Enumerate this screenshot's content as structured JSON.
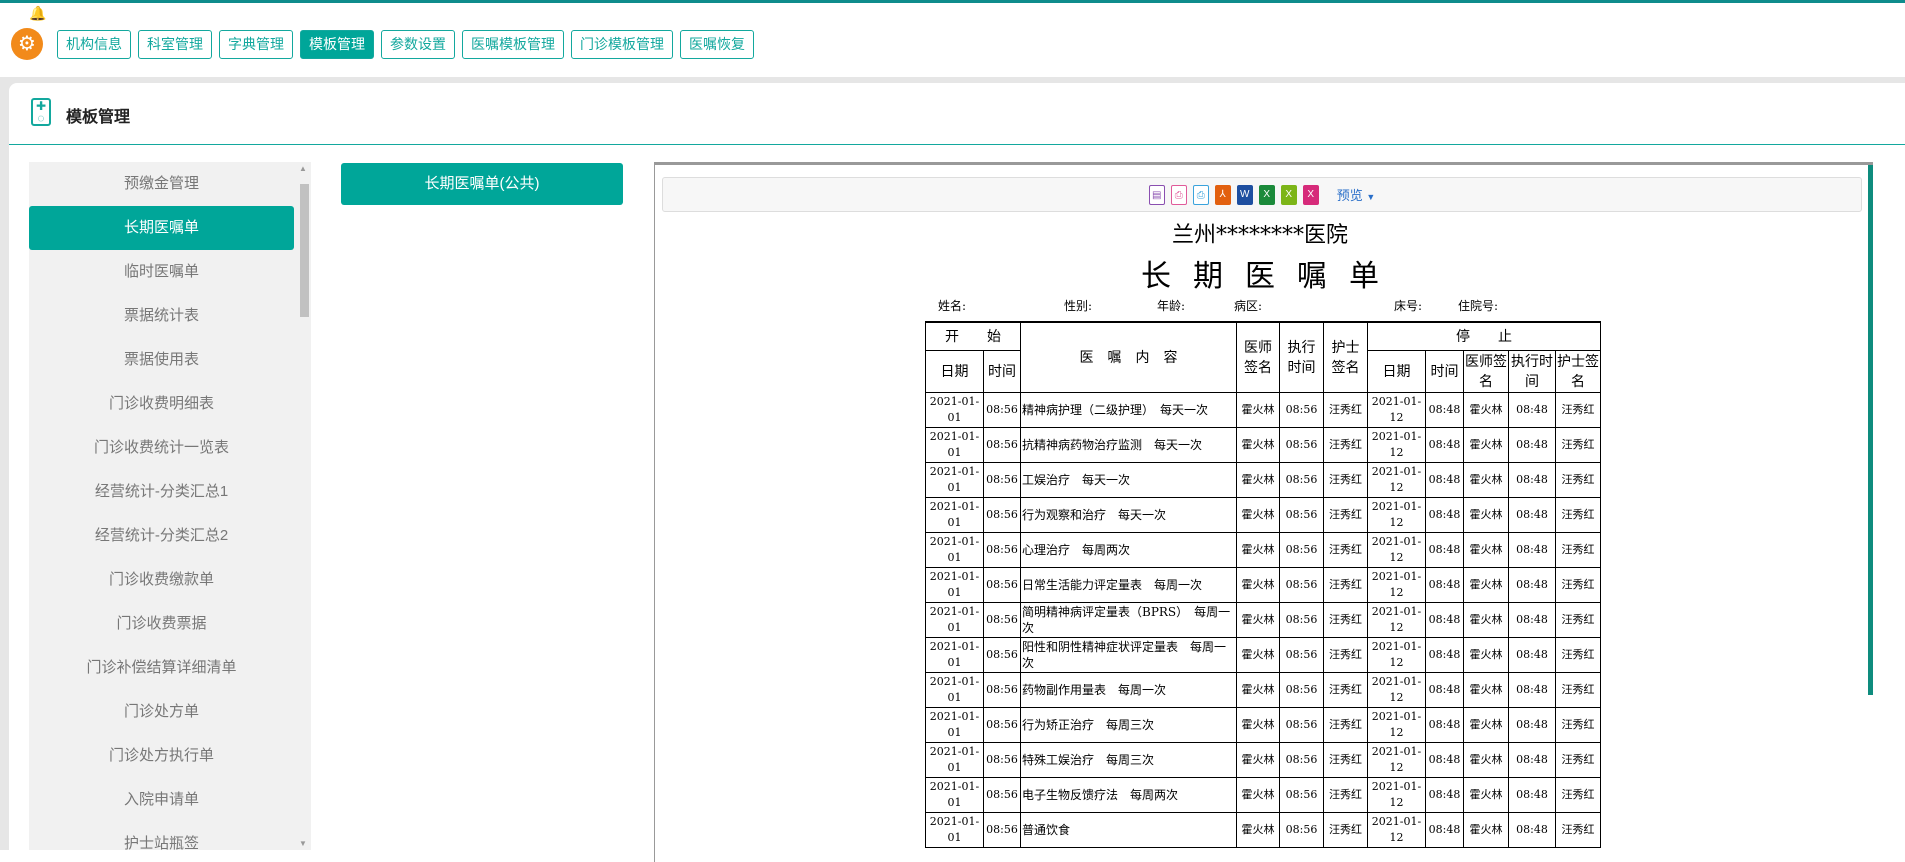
{
  "nav": {
    "items": [
      "机构信息",
      "科室管理",
      "字典管理",
      "模板管理",
      "参数设置",
      "医嘱模板管理",
      "门诊模板管理",
      "医嘱恢复"
    ],
    "active": 3
  },
  "page": {
    "title": "模板管理"
  },
  "sidebar": {
    "items": [
      "预缴金管理",
      "长期医嘱单",
      "临时医嘱单",
      "票据统计表",
      "票据使用表",
      "门诊收费明细表",
      "门诊收费统计一览表",
      "经营统计-分类汇总1",
      "经营统计-分类汇总2",
      "门诊收费缴款单",
      "门诊收费票据",
      "门诊补偿结算详细清单",
      "门诊处方单",
      "门诊处方执行单",
      "入院申请单",
      "护士站瓶签"
    ],
    "active": 1
  },
  "template": {
    "label": "长期医嘱单(公共)"
  },
  "toolbar": {
    "preview": "预览"
  },
  "doc": {
    "hospital": "兰州********医院",
    "title": "长期医嘱单",
    "info": {
      "name": "姓名:",
      "sex": "性别:",
      "age": "年龄:",
      "ward": "病区:",
      "bed": "床号:",
      "inpatient": "住院号:"
    },
    "headers": {
      "start": "开　　始",
      "content": "医　嘱　内　容",
      "doctor": "医师签名",
      "exec": "执行时间",
      "nurse": "护士签名",
      "stop": "停　　止",
      "date": "日期",
      "time": "时间"
    },
    "rows": [
      [
        "2021-01-01",
        "08:56",
        "精神病护理（二级护理）　每天一次",
        "霍火林",
        "08:56",
        "汪秀红",
        "2021-01-12",
        "08:48",
        "霍火林",
        "08:48",
        "汪秀红"
      ],
      [
        "2021-01-01",
        "08:56",
        "抗精神病药物治疗监测　每天一次",
        "霍火林",
        "08:56",
        "汪秀红",
        "2021-01-12",
        "08:48",
        "霍火林",
        "08:48",
        "汪秀红"
      ],
      [
        "2021-01-01",
        "08:56",
        "工娱治疗　每天一次",
        "霍火林",
        "08:56",
        "汪秀红",
        "2021-01-12",
        "08:48",
        "霍火林",
        "08:48",
        "汪秀红"
      ],
      [
        "2021-01-01",
        "08:56",
        "行为观察和治疗　每天一次",
        "霍火林",
        "08:56",
        "汪秀红",
        "2021-01-12",
        "08:48",
        "霍火林",
        "08:48",
        "汪秀红"
      ],
      [
        "2021-01-01",
        "08:56",
        "心理治疗　每周两次",
        "霍火林",
        "08:56",
        "汪秀红",
        "2021-01-12",
        "08:48",
        "霍火林",
        "08:48",
        "汪秀红"
      ],
      [
        "2021-01-01",
        "08:56",
        "日常生活能力评定量表　每周一次",
        "霍火林",
        "08:56",
        "汪秀红",
        "2021-01-12",
        "08:48",
        "霍火林",
        "08:48",
        "汪秀红"
      ],
      [
        "2021-01-01",
        "08:56",
        "简明精神病评定量表（BPRS）　每周一次",
        "霍火林",
        "08:56",
        "汪秀红",
        "2021-01-12",
        "08:48",
        "霍火林",
        "08:48",
        "汪秀红"
      ],
      [
        "2021-01-01",
        "08:56",
        "阳性和阴性精神症状评定量表　每周一次",
        "霍火林",
        "08:56",
        "汪秀红",
        "2021-01-12",
        "08:48",
        "霍火林",
        "08:48",
        "汪秀红"
      ],
      [
        "2021-01-01",
        "08:56",
        "药物副作用量表　每周一次",
        "霍火林",
        "08:56",
        "汪秀红",
        "2021-01-12",
        "08:48",
        "霍火林",
        "08:48",
        "汪秀红"
      ],
      [
        "2021-01-01",
        "08:56",
        "行为矫正治疗　每周三次",
        "霍火林",
        "08:56",
        "汪秀红",
        "2021-01-12",
        "08:48",
        "霍火林",
        "08:48",
        "汪秀红"
      ],
      [
        "2021-01-01",
        "08:56",
        "特殊工娱治疗　每周三次",
        "霍火林",
        "08:56",
        "汪秀红",
        "2021-01-12",
        "08:48",
        "霍火林",
        "08:48",
        "汪秀红"
      ],
      [
        "2021-01-01",
        "08:56",
        "电子生物反馈疗法　每周两次",
        "霍火林",
        "08:56",
        "汪秀红",
        "2021-01-12",
        "08:48",
        "霍火林",
        "08:48",
        "汪秀红"
      ],
      [
        "2021-01-01",
        "08:56",
        "普通饮食",
        "霍火林",
        "08:56",
        "汪秀红",
        "2021-01-12",
        "08:48",
        "霍火林",
        "08:48",
        "汪秀红"
      ]
    ]
  },
  "colors": {
    "accent": "#00a699",
    "logo": "#f28a1a"
  }
}
